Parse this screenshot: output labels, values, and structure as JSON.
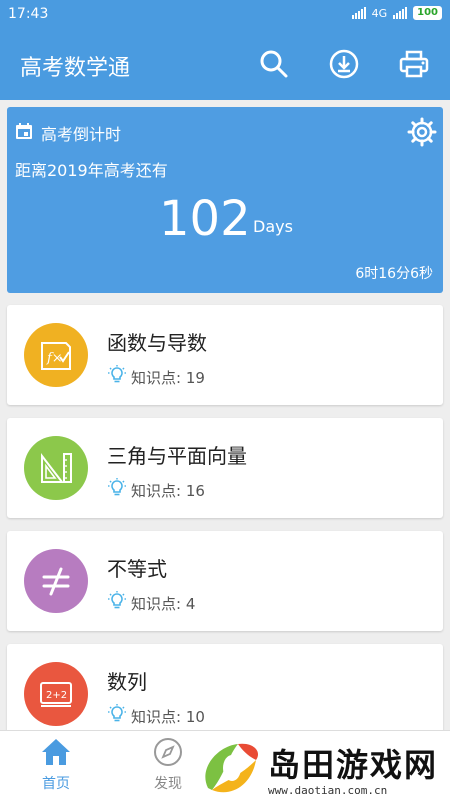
{
  "status_bar": {
    "time": "17:43",
    "network": "4G",
    "battery": "100"
  },
  "app_bar": {
    "title": "高考数学通"
  },
  "countdown": {
    "title": "高考倒计时",
    "subtitle": "距离2019年高考还有",
    "days": "102",
    "days_unit": "Days",
    "remaining": "6时16分6秒"
  },
  "topics": [
    {
      "name": "函数与导数",
      "points_label": "知识点: 19",
      "color": "#f0b122",
      "icon": "fx-icon"
    },
    {
      "name": "三角与平面向量",
      "points_label": "知识点: 16",
      "color": "#8cc84b",
      "icon": "ruler-triangle-icon"
    },
    {
      "name": "不等式",
      "points_label": "知识点: 4",
      "color": "#b77cc0",
      "icon": "not-equal-icon"
    },
    {
      "name": "数列",
      "points_label": "知识点: 10",
      "color": "#e9573f",
      "icon": "blackboard-icon"
    }
  ],
  "bottom_nav": {
    "home": "首页",
    "discover": "发现"
  },
  "watermark": {
    "title": "岛田游戏网",
    "url": "www.daotian.com.cn"
  },
  "colors": {
    "primary": "#4a9be0",
    "hint": "#4ab3e8"
  }
}
